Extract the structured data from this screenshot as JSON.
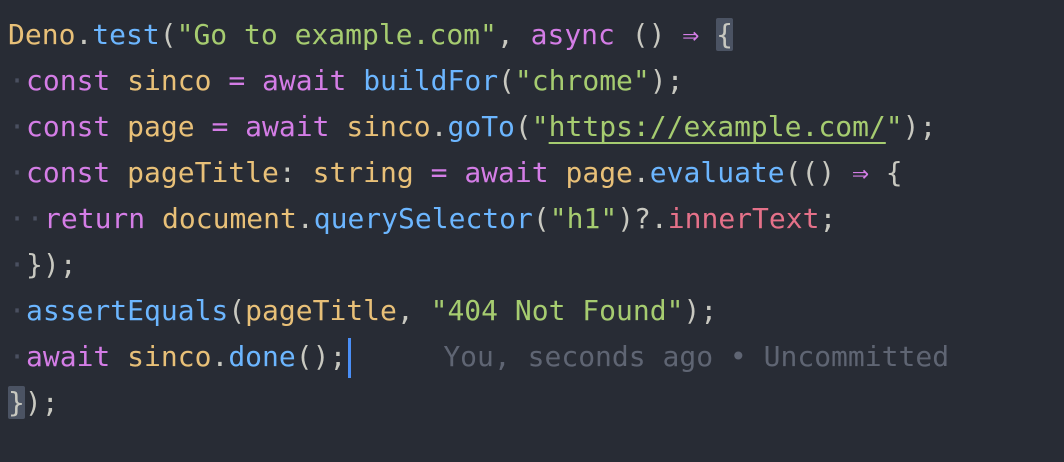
{
  "code": {
    "l1": {
      "obj": "Deno",
      "dot": ".",
      "fn": "test",
      "open": "(",
      "str": "\"Go to example.com\"",
      "comma": ", ",
      "kw": "async",
      "sp": " ",
      "parens": "()",
      "sp2": " ",
      "arrow": "⇒",
      "sp3": " ",
      "brace": "{"
    },
    "l2": {
      "kw": "const",
      "var": "sinco",
      "eq": "=",
      "kw2": "await",
      "fn": "buildFor",
      "open": "(",
      "str": "\"chrome\"",
      "close": ");"
    },
    "l3": {
      "kw": "const",
      "var": "page",
      "eq": "=",
      "kw2": "await",
      "obj": "sinco",
      "dot": ".",
      "fn": "goTo",
      "open": "(",
      "q1": "\"",
      "url": "https://example.com/",
      "q2": "\"",
      "close": ");"
    },
    "l4": {
      "kw": "const",
      "var": "pageTitle",
      "colon": ":",
      "type": "string",
      "eq": "=",
      "kw2": "await",
      "obj": "page",
      "dot": ".",
      "fn": "evaluate",
      "open": "(()",
      "arrow": "⇒",
      "brace": "{"
    },
    "l5": {
      "kw": "return",
      "obj": "document",
      "dot": ".",
      "fn": "querySelector",
      "open": "(",
      "str": "\"h1\"",
      "close": ")",
      "opt": "?.",
      "prop": "innerText",
      "semi": ";"
    },
    "l6": {
      "close": "});"
    },
    "l7": {
      "fn": "assertEquals",
      "open": "(",
      "obj": "pageTitle",
      "comma": ", ",
      "str": "\"404 Not Found\"",
      "close": ");"
    },
    "l8": {
      "kw": "await",
      "obj": "sinco",
      "dot": ".",
      "fn": "done",
      "close": "();",
      "blame": "You, seconds ago • Uncommitted"
    },
    "l9": {
      "brace": "}",
      "close": ");"
    }
  },
  "colors": {
    "background": "#282c35",
    "function": "#6cb6ff",
    "string": "#a6cc70",
    "keyword": "#d47de6",
    "identifier": "#e8c078",
    "property": "#e57189",
    "cursor": "#4a8ff7"
  }
}
